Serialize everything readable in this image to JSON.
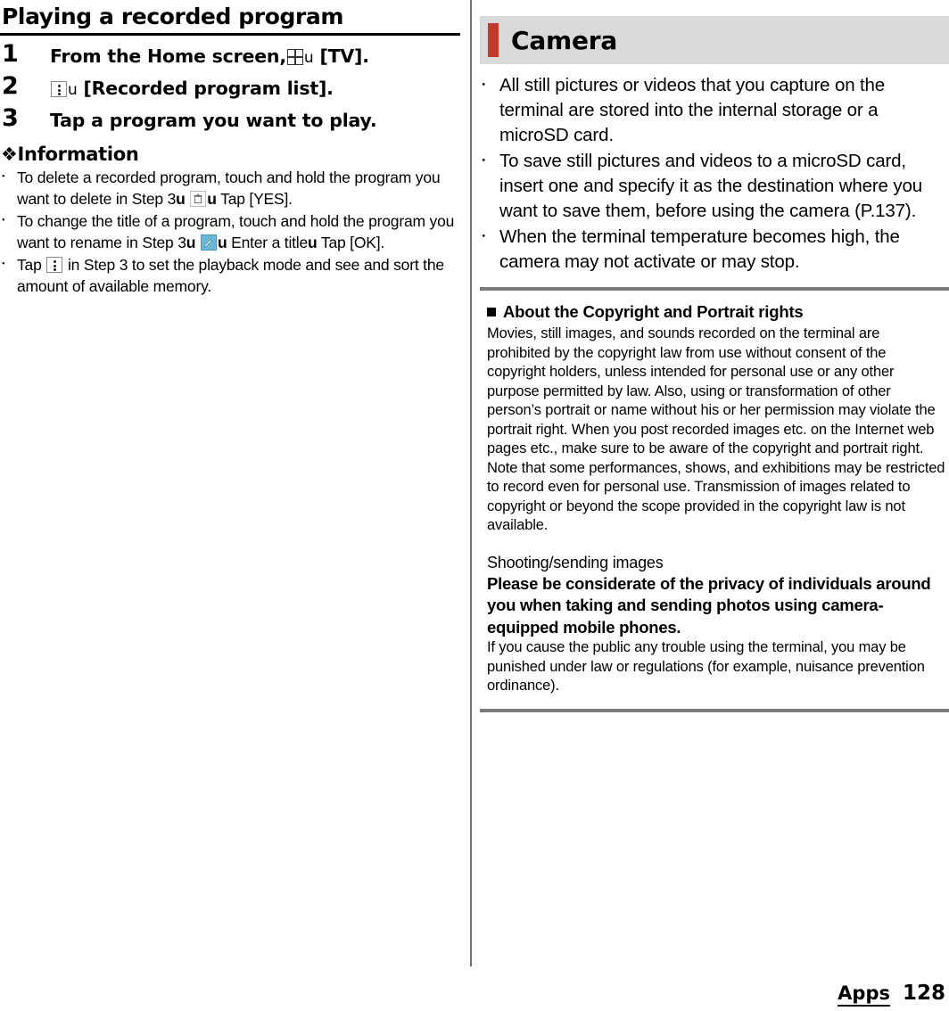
{
  "left": {
    "title": "Playing a recorded program",
    "steps": [
      {
        "num": "1",
        "pre": "From the Home screen,",
        "icon": "grid-apps-icon",
        "mid": "u",
        "post": "[TV]."
      },
      {
        "num": "2",
        "pre": "",
        "icon": "overflow-menu-icon",
        "mid": "u",
        "post": "[Recorded program list]."
      },
      {
        "num": "3",
        "pre": "Tap a program you want to play.",
        "icon": "",
        "mid": "",
        "post": ""
      }
    ],
    "information_heading": "❖Information",
    "notes": [
      {
        "marker": "･",
        "part1": "To delete a recorded program, touch and hold the program you want to delete in Step 3",
        "arrow1": "u",
        "icon1": "trash-icon",
        "arrow2": "u",
        "part2": "Tap [YES]."
      },
      {
        "marker": "･",
        "part1": "To change the title of a program, touch and hold the program you want to rename in Step 3",
        "arrow1": "u",
        "icon1": "pencil-edit-icon",
        "arrow2": "u",
        "part2": "Enter a title",
        "arrow3": "u",
        "part3": "Tap [OK]."
      },
      {
        "marker": "･",
        "part1": "Tap",
        "icon1": "overflow-menu-icon",
        "part2": "in Step 3 to set the playback mode and see and sort the amount of available memory."
      }
    ]
  },
  "right": {
    "header": "Camera",
    "bullets": [
      "All still pictures or videos that you capture on the terminal are stored into the internal storage or a microSD card.",
      "To save still pictures and videos to a microSD card, insert one and specify it as the destination where you want to save them, before using the camera (P.137).",
      "When the terminal temperature becomes high, the camera may not activate or may stop."
    ],
    "bullet_marker": "･",
    "copyright_heading": "About the Copyright and Portrait rights",
    "copyright_body": "Movies, still images, and sounds recorded on the terminal are prohibited by the copyright law from use without consent of the copyright holders, unless intended for personal use or any other purpose permitted by law. Also, using or transformation of other person’s portrait or name without his or her permission may violate the portrait right. When you post recorded images etc. on the Internet web pages etc., make sure to be aware of the copyright and portrait right. Note that some performances, shows, and exhibitions may be restricted to record even for personal use. Transmission of images related to copyright or beyond the scope provided in the copyright law is not available.",
    "shooting_heading": "Shooting/sending images",
    "shooting_bold": "Please be considerate of the privacy of individuals around you when taking and sending photos using camera-equipped mobile phones.",
    "shooting_body": "If you cause the public any trouble using the terminal, you may be punished under law or regulations (for example, nuisance prevention ordinance)."
  },
  "footer": {
    "chapter": "Apps",
    "page": "128"
  },
  "colors": {
    "accent_red": "#c0392b",
    "header_bg": "#d9d9d9",
    "rule_gray": "#7a7b7d"
  }
}
